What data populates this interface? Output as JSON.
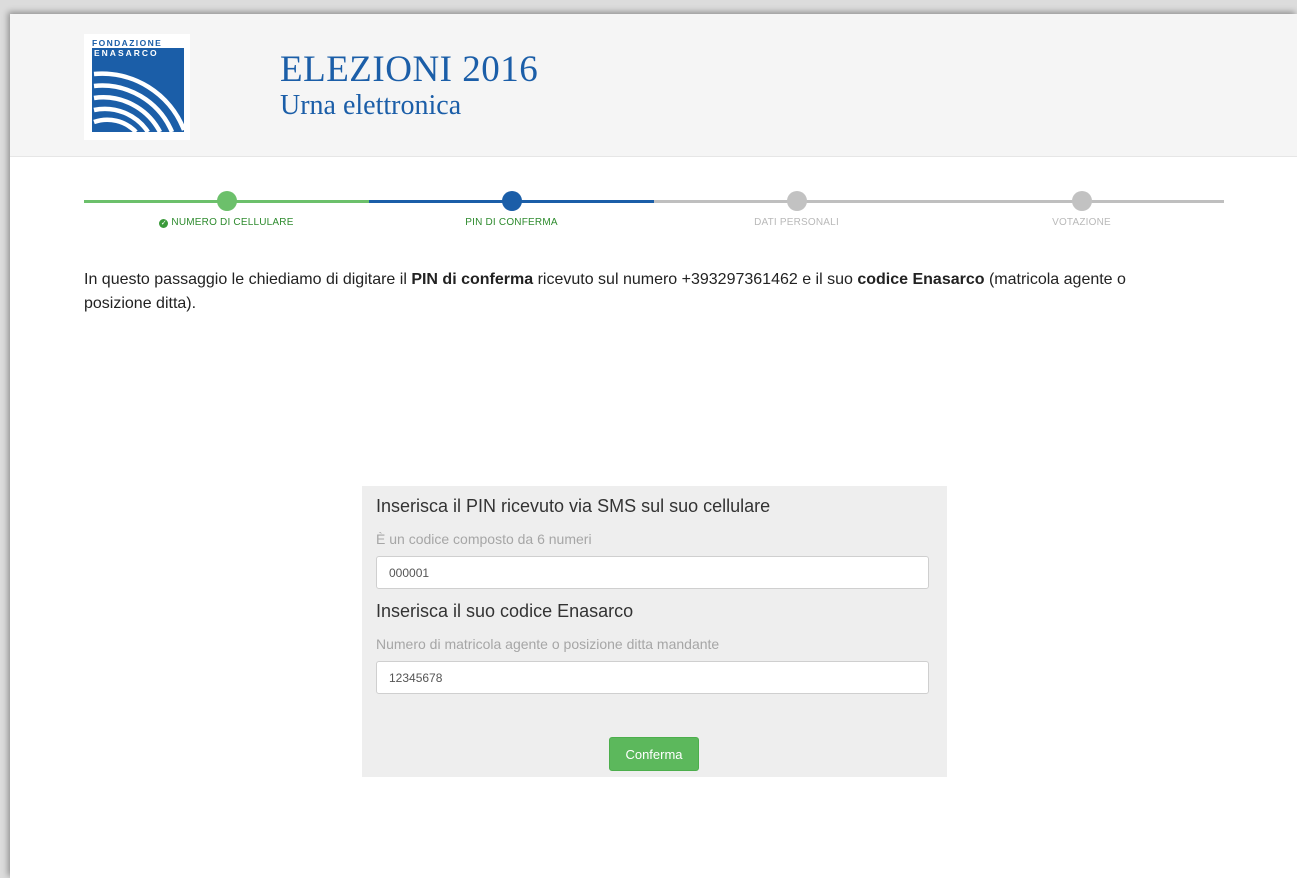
{
  "header": {
    "logo_text_line1": "FONDAZIONE",
    "logo_text_line2": "ENASARCO",
    "title": "ELEZIONI 2016",
    "subtitle": "Urna elettronica"
  },
  "stepper": {
    "steps": [
      {
        "label": "NUMERO DI CELLULARE",
        "state": "done"
      },
      {
        "label": "PIN DI CONFERMA",
        "state": "active"
      },
      {
        "label": "DATI PERSONALI",
        "state": "todo"
      },
      {
        "label": "VOTAZIONE",
        "state": "todo"
      }
    ]
  },
  "intro": {
    "part1": "In questo passaggio le chiediamo di digitare il ",
    "bold1": "PIN di conferma",
    "part2": " ricevuto sul numero +393297361462 e il suo ",
    "bold2": "codice Enasarco",
    "part3": " (matricola agente o posizione ditta)."
  },
  "form": {
    "pin_title": "Inserisca il PIN ricevuto via SMS sul suo cellulare",
    "pin_hint": "È un codice composto da 6 numeri",
    "pin_value": "000001",
    "code_title": "Inserisca il suo codice Enasarco",
    "code_hint": "Numero di matricola agente o posizione ditta mandante",
    "code_value": "12345678",
    "confirm_label": "Conferma"
  },
  "colors": {
    "brand_blue": "#1b5ea8",
    "success_green": "#5cb85c",
    "inactive_grey": "#c2c2c2"
  }
}
